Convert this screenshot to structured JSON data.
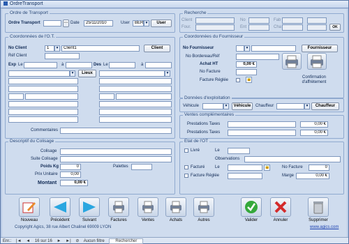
{
  "window": {
    "title": "OrdreTransport"
  },
  "ordre": {
    "legend": "Ordre de Transport",
    "ordre_label": "Ordre Transport",
    "ordre_value": "",
    "ordre_btn": "···",
    "date_label": "Date",
    "date_value": "25/11/2010",
    "user_label": "User",
    "user_value": "BER",
    "user_btn": "User"
  },
  "recherche": {
    "legend": "Recherche",
    "client": "Client",
    "four": "Four.",
    "no": "No",
    "ent": "Ent",
    "fab": "Fab",
    "cha": "Cha",
    "ok": "OK"
  },
  "ot": {
    "legend": "Coordonnées de l'O.T.",
    "no_client": "No Client",
    "no_client_val": "1",
    "client_name": "Client1",
    "client_btn": "Client",
    "ref_client": "Réf Client",
    "exp": "Exp",
    "le": "Le",
    "a": "à",
    "des": "Des",
    "lieux_btn": "Lieux",
    "commentaires": "Commentaires"
  },
  "fournisseur": {
    "legend": "Coordonnées du Fournisseur",
    "no_four": "No Fournisseur",
    "four_btn": "Fournisseur",
    "no_bordereau": "No Bordereau/Réf",
    "achat_ht": "Achat HT",
    "achat_ht_val": "0,00 €",
    "no_facture": "No Facture",
    "facture_reglee": "Facture Réglée",
    "confirmation": "Confirmation d'affrètement"
  },
  "exploitation": {
    "legend": "Données d'exploitation",
    "vehicule": "Véhicule",
    "vehicule_btn": "Véhicule",
    "chauffeur": "Chauffeur",
    "chauffeur_btn": "Chauffeur"
  },
  "ventes": {
    "legend": "Ventes complémentaires",
    "taxes1": "Prestations Taxes",
    "taxes1_val": "0,00 €",
    "taxes2": "Prestations Taxes",
    "taxes2_val": "0,00 €"
  },
  "colisage": {
    "legend": "Descriptif du Colisage",
    "colisage": "Colisage",
    "suite": "Suite Colisage",
    "poids": "Poids Kg",
    "poids_val": "0",
    "palettes": "Palettes",
    "prix": "Prix Unitaire",
    "prix_val": "0,00",
    "montant": "Montant",
    "montant_val": "0,00 €"
  },
  "etat": {
    "legend": "Etat de l'OT",
    "livre": "Livré",
    "le": "Le",
    "observations": "Observations",
    "facture": "Facturé",
    "no_facture": "No Facture",
    "facture_val": "0",
    "facture_reglee": "Facture Réglée",
    "marge": "Marge",
    "marge_val": "0,00 €"
  },
  "toolbar": [
    {
      "label": "Nouveau",
      "icon": "edit-icon"
    },
    {
      "label": "Précédent",
      "icon": "arrow-left-icon"
    },
    {
      "label": "Suivant",
      "icon": "arrow-right-icon"
    },
    {
      "label": "Factures",
      "icon": "printer-icon"
    },
    {
      "label": "Ventes",
      "icon": "printer-icon"
    },
    {
      "label": "Achats",
      "icon": "printer-icon"
    },
    {
      "label": "Autres",
      "icon": "printer-icon"
    },
    {
      "label": "Valider",
      "icon": "check-icon"
    },
    {
      "label": "Annuler",
      "icon": "cross-icon"
    },
    {
      "label": "Supprimer",
      "icon": "trash-icon"
    }
  ],
  "footer": {
    "copyright": "Copyright Agics, 38 rue Albert Chalinel 69009 LYON",
    "website": "www.agics.com"
  },
  "status": {
    "record": "Enr.:",
    "position": "16 sur 16",
    "filter": "Aucun filtre",
    "search": "Rechercher"
  },
  "colors": {
    "accent": "#2b4a7a",
    "background": "#cfdcee",
    "field": "#ffffff"
  }
}
